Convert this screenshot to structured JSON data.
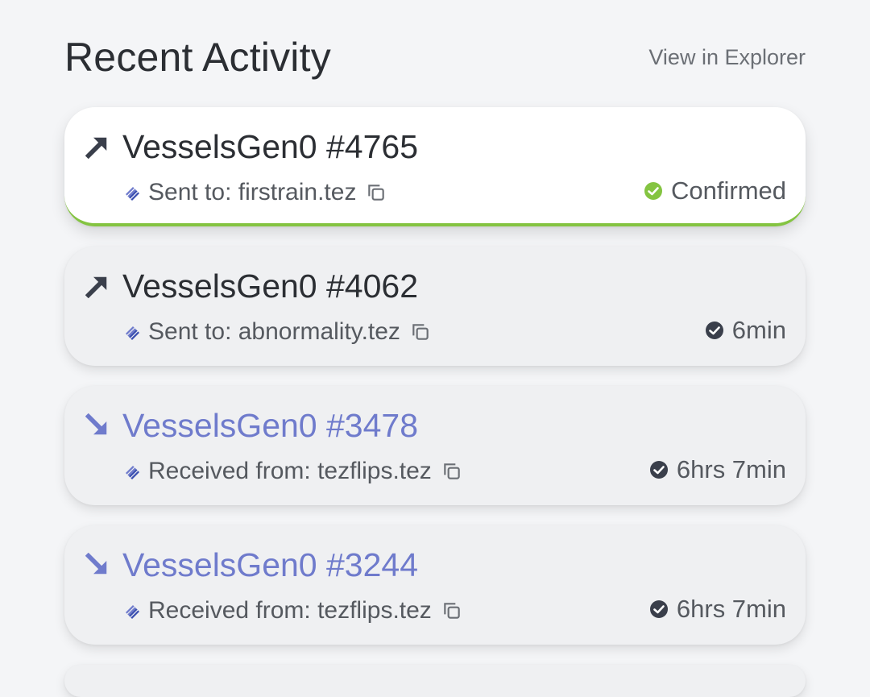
{
  "header": {
    "title": "Recent Activity",
    "explorer_link": "View in Explorer"
  },
  "colors": {
    "confirmed_green": "#84c441",
    "incoming_accent": "#6f7bcc",
    "outgoing_dark": "#3a3f4b",
    "card_bg": "#eff0f2"
  },
  "activities": [
    {
      "direction": "sent",
      "direction_icon": "arrow-up-right-icon",
      "title": "VesselsGen0 #4765",
      "subtitle": "Sent to: firstrain.tez",
      "status_icon": "green-check-circle-icon",
      "status": "Confirmed",
      "highlighted": true
    },
    {
      "direction": "sent",
      "direction_icon": "arrow-up-right-icon",
      "title": "VesselsGen0 #4062",
      "subtitle": "Sent to: abnormality.tez",
      "status_icon": "check-circle-icon",
      "status": "6min",
      "highlighted": false
    },
    {
      "direction": "received",
      "direction_icon": "arrow-down-right-icon",
      "title": "VesselsGen0 #3478",
      "subtitle": "Received from: tezflips.tez",
      "status_icon": "check-circle-icon",
      "status": "6hrs 7min",
      "highlighted": false
    },
    {
      "direction": "received",
      "direction_icon": "arrow-down-right-icon",
      "title": "VesselsGen0 #3244",
      "subtitle": "Received from: tezflips.tez",
      "status_icon": "check-circle-icon",
      "status": "6hrs 7min",
      "highlighted": false
    }
  ]
}
